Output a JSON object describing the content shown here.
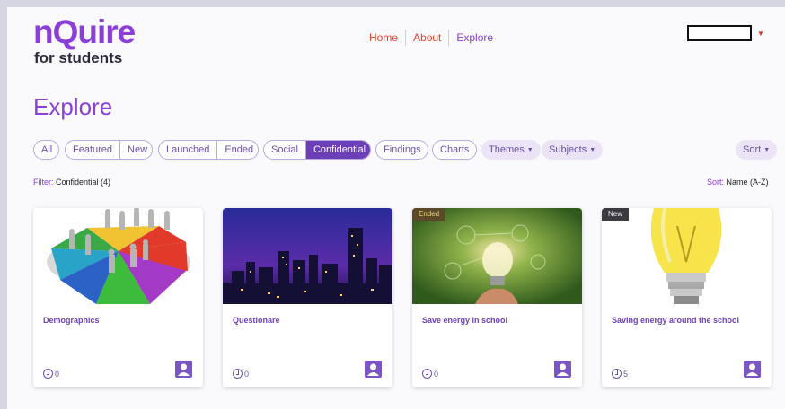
{
  "header": {
    "logo_main": "nQuire",
    "logo_sub": "for students",
    "nav": [
      {
        "label": "Home",
        "active": false
      },
      {
        "label": "About",
        "active": false
      },
      {
        "label": "Explore",
        "active": true
      }
    ]
  },
  "page_title": "Explore",
  "filters": {
    "group1": [
      "All"
    ],
    "group2": [
      "Featured",
      "New"
    ],
    "group3": [
      "Launched",
      "Ended"
    ],
    "group4": [
      "Social",
      "Confidential"
    ],
    "group5": [
      "Findings"
    ],
    "group6": [
      "Charts"
    ],
    "themes": "Themes",
    "subjects": "Subjects",
    "sort": "Sort",
    "active": "Confidential"
  },
  "status": {
    "filter_label": "Filter:",
    "filter_value": "Confidential (4)",
    "sort_label": "Sort:",
    "sort_value": "Name (A-Z)"
  },
  "cards": [
    {
      "title": "Demographics",
      "count": "0",
      "badge": ""
    },
    {
      "title": "Questionare",
      "count": "0",
      "badge": ""
    },
    {
      "title": "Save energy in school",
      "count": "0",
      "badge": "Ended"
    },
    {
      "title": "Saving energy around the school",
      "count": "5",
      "badge": "New"
    }
  ],
  "colors": {
    "brand": "#8a3fd6",
    "nav_link": "#e0452d",
    "active_pill": "#6c3fb8"
  }
}
